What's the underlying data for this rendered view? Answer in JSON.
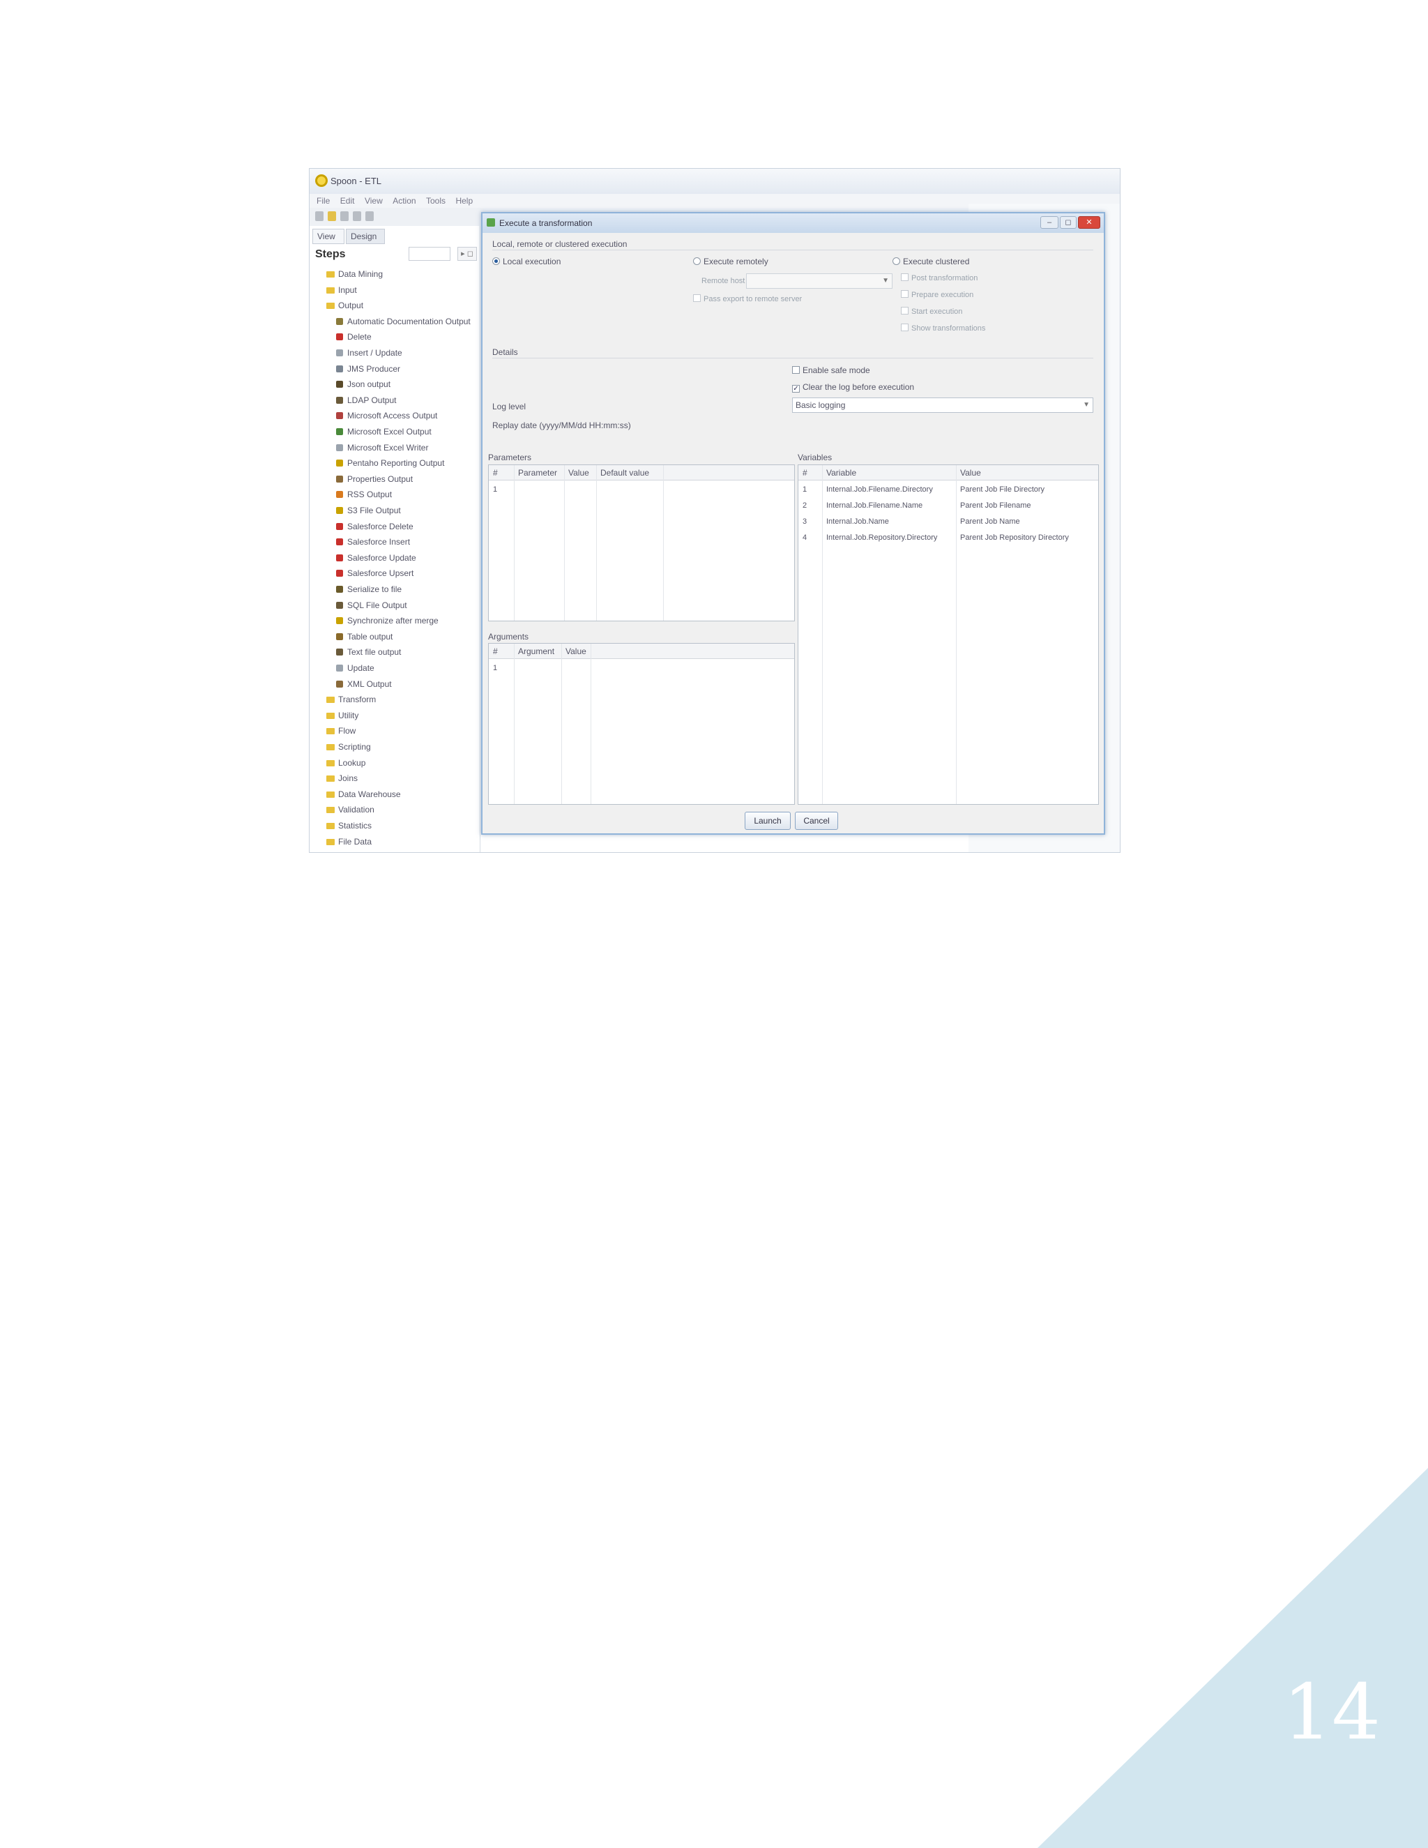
{
  "page": {
    "number": "14",
    "accent_color": "#d2e6ef"
  },
  "app": {
    "title": "Spoon - ETL",
    "menu": [
      "File",
      "Edit",
      "View",
      "Action",
      "Tools",
      "Help"
    ],
    "view_tabs": [
      "View",
      "Design"
    ],
    "steps_header": "Steps",
    "steps_buttons": "▸ ◻",
    "tree": [
      {
        "label": "Data Mining",
        "level": 0,
        "kind": "folder"
      },
      {
        "label": "Input",
        "level": 0,
        "kind": "folder"
      },
      {
        "label": "Output",
        "level": 0,
        "kind": "folder"
      },
      {
        "label": "Automatic Documentation Output",
        "level": 1,
        "kind": "step",
        "color": "#8a7a3a"
      },
      {
        "label": "Delete",
        "level": 1,
        "kind": "step",
        "color": "#c9302c"
      },
      {
        "label": "Insert / Update",
        "level": 1,
        "kind": "step",
        "color": "#9aa3ad"
      },
      {
        "label": "JMS Producer",
        "level": 1,
        "kind": "step",
        "color": "#7a8592"
      },
      {
        "label": "Json output",
        "level": 1,
        "kind": "step",
        "color": "#5a4a2a"
      },
      {
        "label": "LDAP Output",
        "level": 1,
        "kind": "step",
        "color": "#6a5a3a"
      },
      {
        "label": "Microsoft Access Output",
        "level": 1,
        "kind": "step",
        "color": "#b0413e"
      },
      {
        "label": "Microsoft Excel Output",
        "level": 1,
        "kind": "step",
        "color": "#4a8a3a"
      },
      {
        "label": "Microsoft Excel Writer",
        "level": 1,
        "kind": "step",
        "color": "#9aa3ad"
      },
      {
        "label": "Pentaho Reporting Output",
        "level": 1,
        "kind": "step",
        "color": "#c9a200"
      },
      {
        "label": "Properties Output",
        "level": 1,
        "kind": "step",
        "color": "#8a6a3a"
      },
      {
        "label": "RSS Output",
        "level": 1,
        "kind": "step",
        "color": "#d97a1e"
      },
      {
        "label": "S3 File Output",
        "level": 1,
        "kind": "step",
        "color": "#c9a200"
      },
      {
        "label": "Salesforce Delete",
        "level": 1,
        "kind": "step",
        "color": "#c9302c"
      },
      {
        "label": "Salesforce Insert",
        "level": 1,
        "kind": "step",
        "color": "#c9302c"
      },
      {
        "label": "Salesforce Update",
        "level": 1,
        "kind": "step",
        "color": "#c9302c"
      },
      {
        "label": "Salesforce Upsert",
        "level": 1,
        "kind": "step",
        "color": "#c9302c"
      },
      {
        "label": "Serialize to file",
        "level": 1,
        "kind": "step",
        "color": "#6a5a2a"
      },
      {
        "label": "SQL File Output",
        "level": 1,
        "kind": "step",
        "color": "#6a5a3a"
      },
      {
        "label": "Synchronize after merge",
        "level": 1,
        "kind": "step",
        "color": "#c9a200"
      },
      {
        "label": "Table output",
        "level": 1,
        "kind": "step",
        "color": "#8a6a2a"
      },
      {
        "label": "Text file output",
        "level": 1,
        "kind": "step",
        "color": "#6a5a3a"
      },
      {
        "label": "Update",
        "level": 1,
        "kind": "step",
        "color": "#9aa3ad"
      },
      {
        "label": "XML Output",
        "level": 1,
        "kind": "step",
        "color": "#8a6a3a"
      },
      {
        "label": "Transform",
        "level": 0,
        "kind": "folder"
      },
      {
        "label": "Utility",
        "level": 0,
        "kind": "folder"
      },
      {
        "label": "Flow",
        "level": 0,
        "kind": "folder"
      },
      {
        "label": "Scripting",
        "level": 0,
        "kind": "folder"
      },
      {
        "label": "Lookup",
        "level": 0,
        "kind": "folder"
      },
      {
        "label": "Joins",
        "level": 0,
        "kind": "folder"
      },
      {
        "label": "Data Warehouse",
        "level": 0,
        "kind": "folder"
      },
      {
        "label": "Validation",
        "level": 0,
        "kind": "folder"
      },
      {
        "label": "Statistics",
        "level": 0,
        "kind": "folder"
      },
      {
        "label": "File Data",
        "level": 0,
        "kind": "folder"
      }
    ]
  },
  "dialog": {
    "title": "Execute a transformation",
    "window_buttons": [
      "–",
      "◻",
      "✕"
    ],
    "execution_section": "Local, remote or clustered execution",
    "local_execution": "Local execution",
    "execute_remotely": "Execute remotely",
    "execute_clustered": "Execute clustered",
    "remote_host_label": "Remote host",
    "pass_export": "Pass export to remote server",
    "cluster_options": [
      "Post transformation",
      "Prepare execution",
      "Start execution",
      "Show transformations"
    ],
    "details_section": "Details",
    "enable_safe_mode": "Enable safe mode",
    "clear_log": "Clear the log before execution",
    "log_level_label": "Log level",
    "log_level_value": "Basic logging",
    "replay_date_label": "Replay date (yyyy/MM/dd HH:mm:ss)",
    "parameters_section": "Parameters",
    "parameters_columns": [
      "#",
      "Parameter",
      "Value",
      "Default value"
    ],
    "parameters_rows": [
      [
        "1",
        "",
        "",
        ""
      ]
    ],
    "variables_section": "Variables",
    "variables_columns": [
      "#",
      "Variable",
      "Value"
    ],
    "variables_rows": [
      [
        "1",
        "Internal.Job.Filename.Directory",
        "Parent Job File Directory"
      ],
      [
        "2",
        "Internal.Job.Filename.Name",
        "Parent Job Filename"
      ],
      [
        "3",
        "Internal.Job.Name",
        "Parent Job Name"
      ],
      [
        "4",
        "Internal.Job.Repository.Directory",
        "Parent Job Repository Directory"
      ]
    ],
    "arguments_section": "Arguments",
    "arguments_columns": [
      "#",
      "Argument",
      "Value"
    ],
    "arguments_rows": [
      [
        "1",
        "",
        ""
      ]
    ],
    "launch_label": "Launch",
    "cancel_label": "Cancel"
  }
}
